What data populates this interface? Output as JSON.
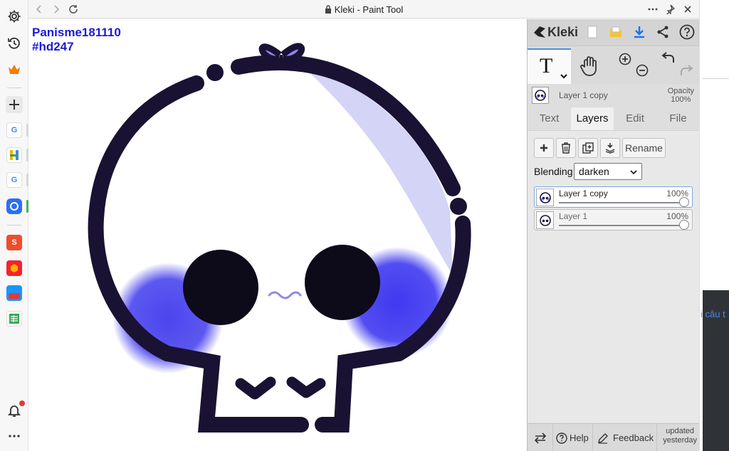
{
  "window": {
    "title": "Kleki - Paint Tool"
  },
  "canvas": {
    "watermark_line1": "Panisme181110",
    "watermark_line2": "#hd247"
  },
  "panel": {
    "logo": "Kleki",
    "current_layer": {
      "name": "Layer 1 copy",
      "opacity_label": "Opacity",
      "opacity_value": "100%"
    },
    "tabs": [
      {
        "label": "Text"
      },
      {
        "label": "Layers",
        "active": true
      },
      {
        "label": "Edit"
      },
      {
        "label": "File"
      }
    ],
    "layer_actions": {
      "rename": "Rename"
    },
    "blending": {
      "label": "Blending",
      "value": "darken"
    },
    "layers": [
      {
        "name": "Layer 1 copy",
        "opacity": "100%",
        "selected": true
      },
      {
        "name": "Layer 1",
        "opacity": "100%",
        "selected": false
      }
    ],
    "footer": {
      "help": "Help",
      "feedback": "Feedback",
      "updated_line1": "updated",
      "updated_line2": "yesterday"
    }
  },
  "background": {
    "text": "i câu t"
  },
  "colors": {
    "accent": "#4a90e2",
    "ink": "#1a1233",
    "blush": "#4b45ee",
    "watermark": "#1a1adb"
  }
}
